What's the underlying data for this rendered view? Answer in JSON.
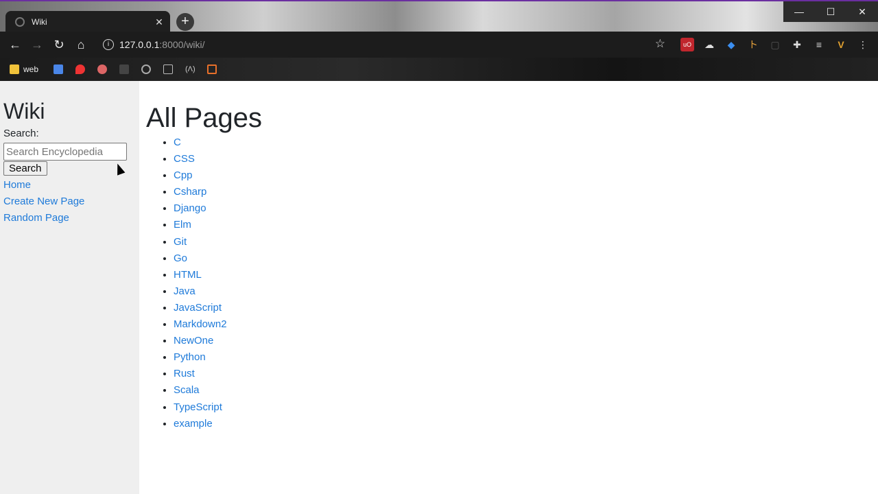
{
  "browser": {
    "tab_title": "Wiki",
    "tab_close": "✕",
    "new_tab": "+",
    "url_host": "127.0.0.1",
    "url_path": ":8000/wiki/",
    "window_controls": {
      "minimize": "—",
      "maximize": "☐",
      "close": "✕"
    },
    "bookmarks": [
      {
        "label": "web"
      }
    ]
  },
  "sidebar": {
    "title": "Wiki",
    "search_label": "Search:",
    "search_placeholder": "Search Encyclopedia",
    "search_button": "Search",
    "nav": [
      {
        "label": "Home"
      },
      {
        "label": "Create New Page"
      },
      {
        "label": "Random Page"
      }
    ]
  },
  "main": {
    "heading": "All Pages",
    "pages": [
      "C",
      "CSS",
      "Cpp",
      "Csharp",
      "Django",
      "Elm",
      "Git",
      "Go",
      "HTML",
      "Java",
      "JavaScript",
      "Markdown2",
      "NewOne",
      "Python",
      "Rust",
      "Scala",
      "TypeScript",
      "example"
    ]
  }
}
